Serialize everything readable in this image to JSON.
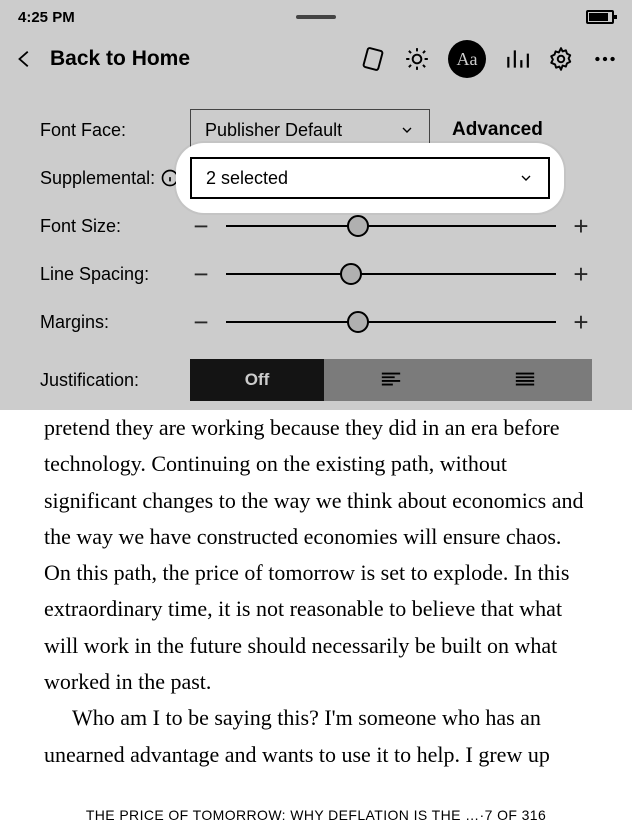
{
  "status": {
    "time": "4:25 PM"
  },
  "back_label": "Back to Home",
  "panel": {
    "font_face_label": "Font Face:",
    "font_face_value": "Publisher Default",
    "advanced_label": "Advanced",
    "supplemental_label": "Supplemental:",
    "supplemental_value": "2 selected",
    "font_size_label": "Font Size:",
    "line_spacing_label": "Line Spacing:",
    "margins_label": "Margins:",
    "justification_label": "Justification:",
    "justification_off": "Off",
    "font_size_pct": 40,
    "line_spacing_pct": 38,
    "margins_pct": 40
  },
  "content": {
    "p1": "pretend they are working because they did in an era before technology. Continuing on the existing path, without significant changes to the way we think about economics and the way we have constructed economies will ensure chaos. On this path, the price of tomorrow is set to explode. In this extraordinary time, it is not reasonable to believe that what will work in the future should necessarily be built on what worked in the past.",
    "p2": "Who am I to be saying this? I'm someone who has an unearned advantage and wants to use it to help. I grew up"
  },
  "footer": {
    "title": "THE PRICE OF TOMORROW: WHY DEFLATION IS THE …",
    "separator": " · ",
    "page": "7 OF 316"
  }
}
